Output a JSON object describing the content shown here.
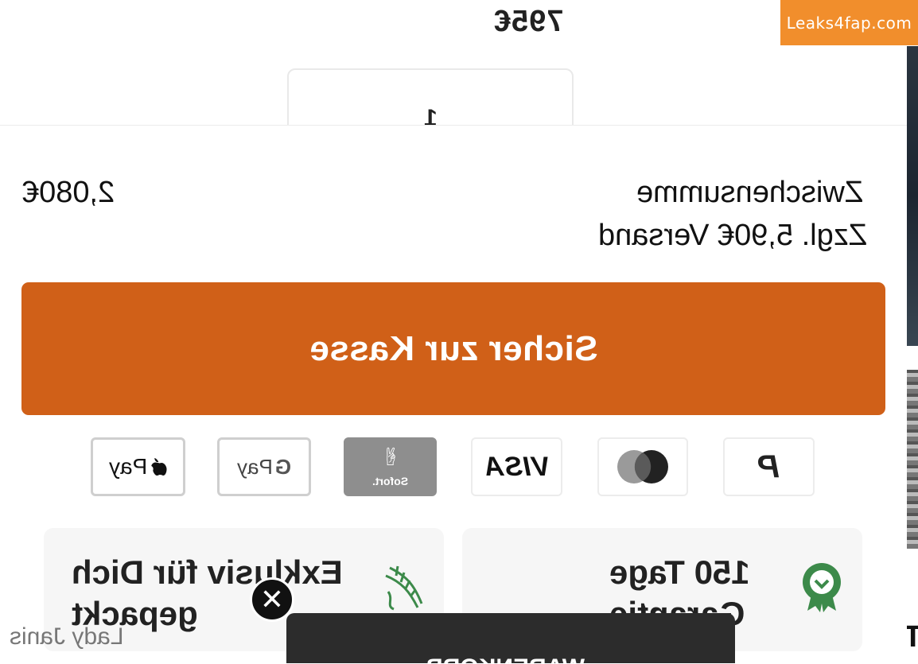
{
  "top": {
    "price": "795€",
    "card_fragment": "1"
  },
  "watermark": "Leaks4fap.com",
  "summary": {
    "subtotal_label": "Zwischensumme",
    "subtotal_value": "2,080€",
    "shipping_note": "Zzgl. 5,90€ Versand"
  },
  "checkout": {
    "label": "Sicher zur Kasse"
  },
  "payments": [
    {
      "name": "apple-pay",
      "label": "Pay"
    },
    {
      "name": "google-pay",
      "label": "Pay"
    },
    {
      "name": "sofort",
      "label": "Sofort."
    },
    {
      "name": "visa",
      "label": "VISA"
    },
    {
      "name": "mastercard",
      "label": ""
    },
    {
      "name": "paypal",
      "label": "P"
    }
  ],
  "features": {
    "exclusive_line1": "Exklusiv für Dich",
    "exclusive_line2": "gepackt",
    "guarantee_line1": "150 Tage",
    "guarantee_line2": "Garantie"
  },
  "creator": "Lady Janis",
  "bottom_bar": {
    "label": "WARENKORB"
  },
  "side_letter": "T",
  "colors": {
    "accent": "#d06018",
    "watermark": "#f18e2c",
    "dark": "#2c2c2c",
    "feature_bg": "#f6f6f6"
  }
}
